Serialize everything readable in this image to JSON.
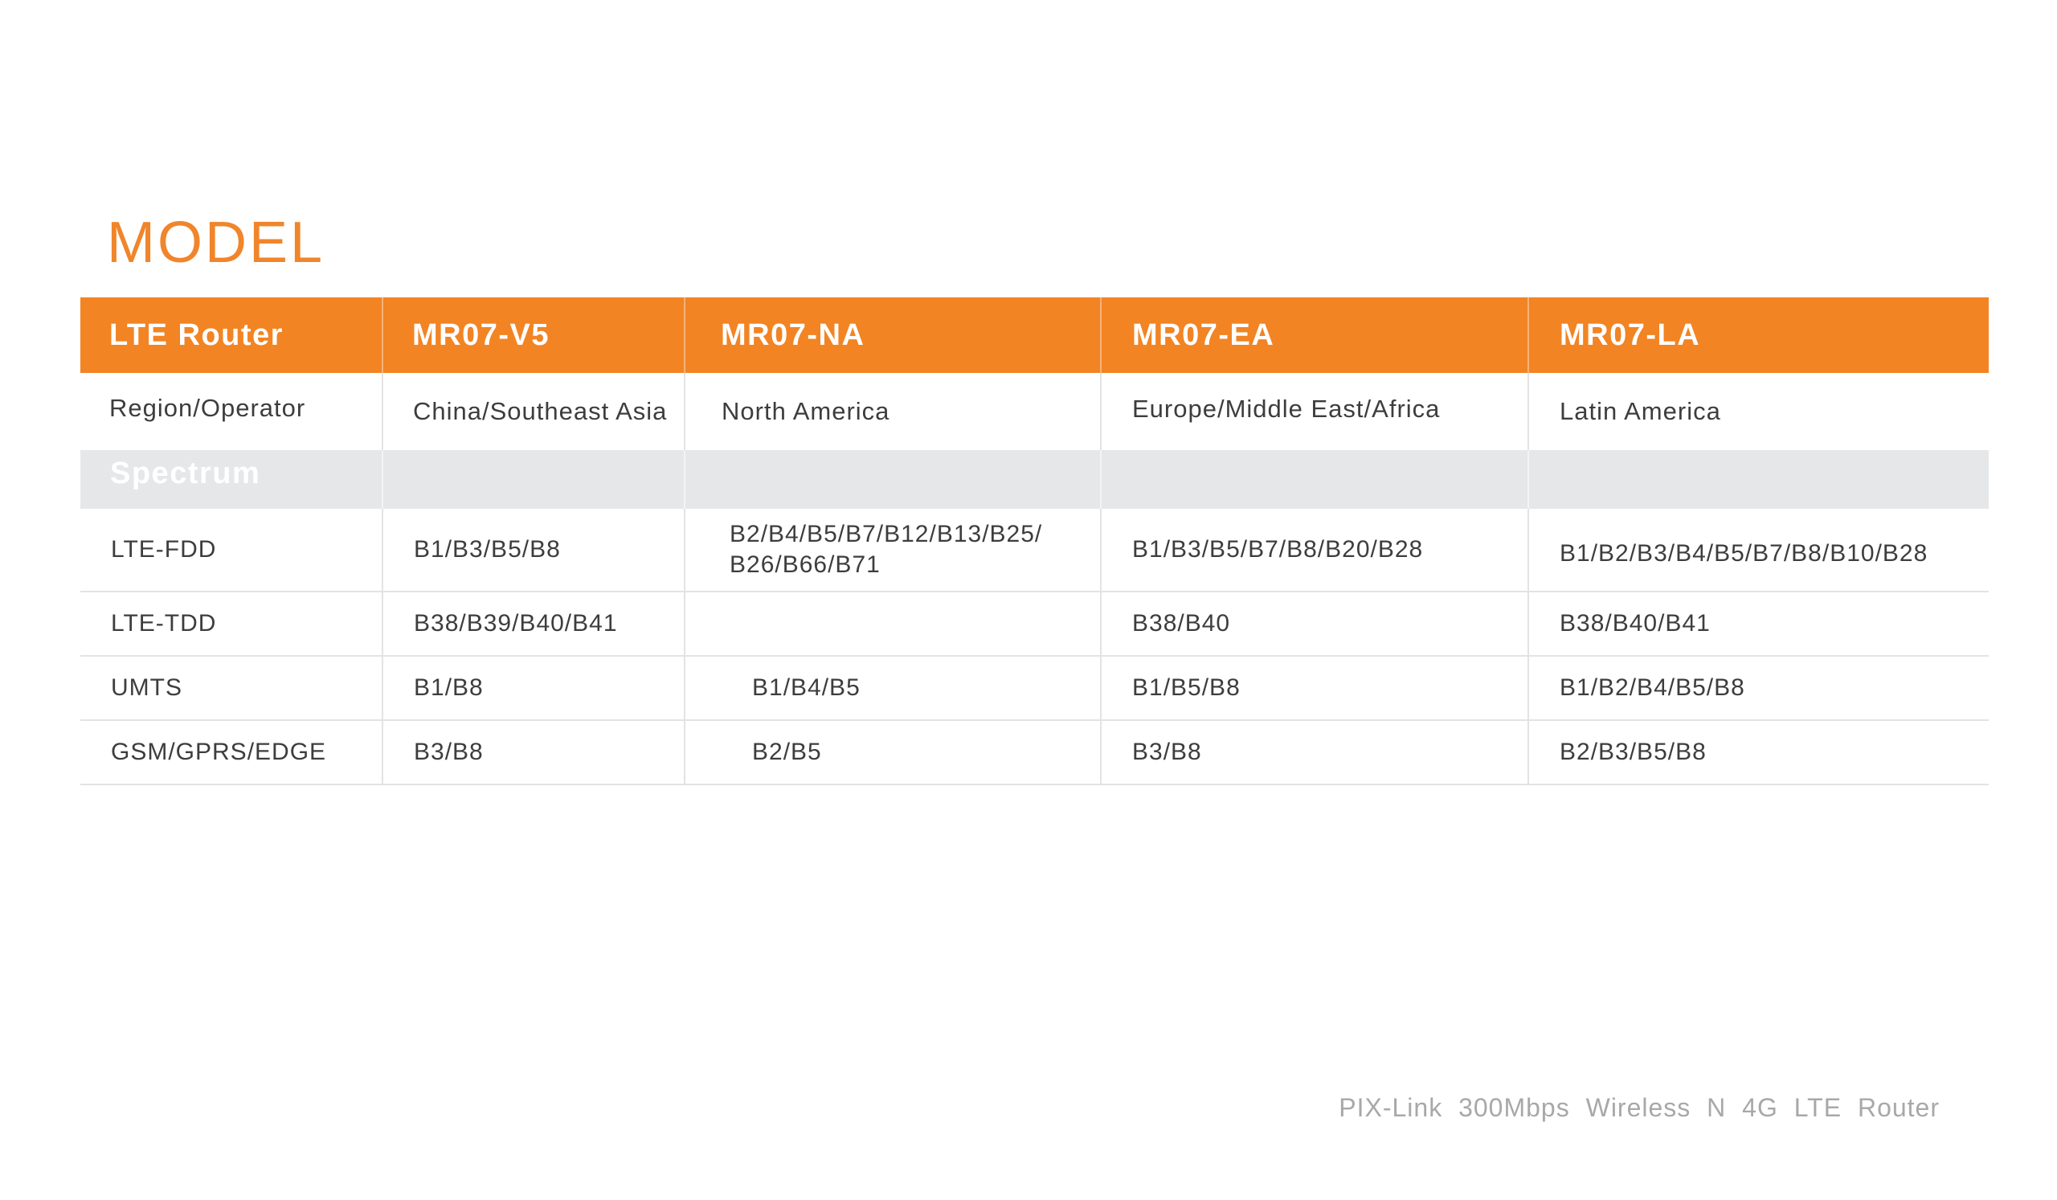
{
  "page": {
    "title": "MODEL",
    "footer": "PIX-Link 300Mbps  Wireless  N  4G  LTE  Router"
  },
  "table": {
    "header": [
      "LTE Router",
      "MR07-V5",
      "MR07-NA",
      "MR07-EA",
      "MR07-LA"
    ],
    "region_row": [
      "Region/Operator",
      "China/Southeast Asia",
      "North America",
      "Europe/Middle East/Africa",
      "Latin America"
    ],
    "section_label": "Spectrum",
    "rows": [
      [
        "LTE-FDD",
        "B1/B3/B5/B8",
        "B2/B4/B5/B7/B12/B13/B25/\nB26/B66/B71",
        "B1/B3/B5/B7/B8/B20/B28",
        "B1/B2/B3/B4/B5/B7/B8/B10/B28"
      ],
      [
        "LTE-TDD",
        "B38/B39/B40/B41",
        "",
        "B38/B40",
        "B38/B40/B41"
      ],
      [
        "UMTS",
        "B1/B8",
        "B1/B4/B5",
        "B1/B5/B8",
        "B1/B2/B4/B5/B8"
      ],
      [
        "GSM/GPRS/EDGE",
        "B3/B8",
        "B2/B5",
        "B3/B8",
        "B2/B3/B5/B8"
      ]
    ]
  },
  "colors": {
    "accent": "#f28423",
    "title": "#f0852b",
    "section_bg": "#e6e7e9",
    "footer_text": "#a8a8a8"
  }
}
